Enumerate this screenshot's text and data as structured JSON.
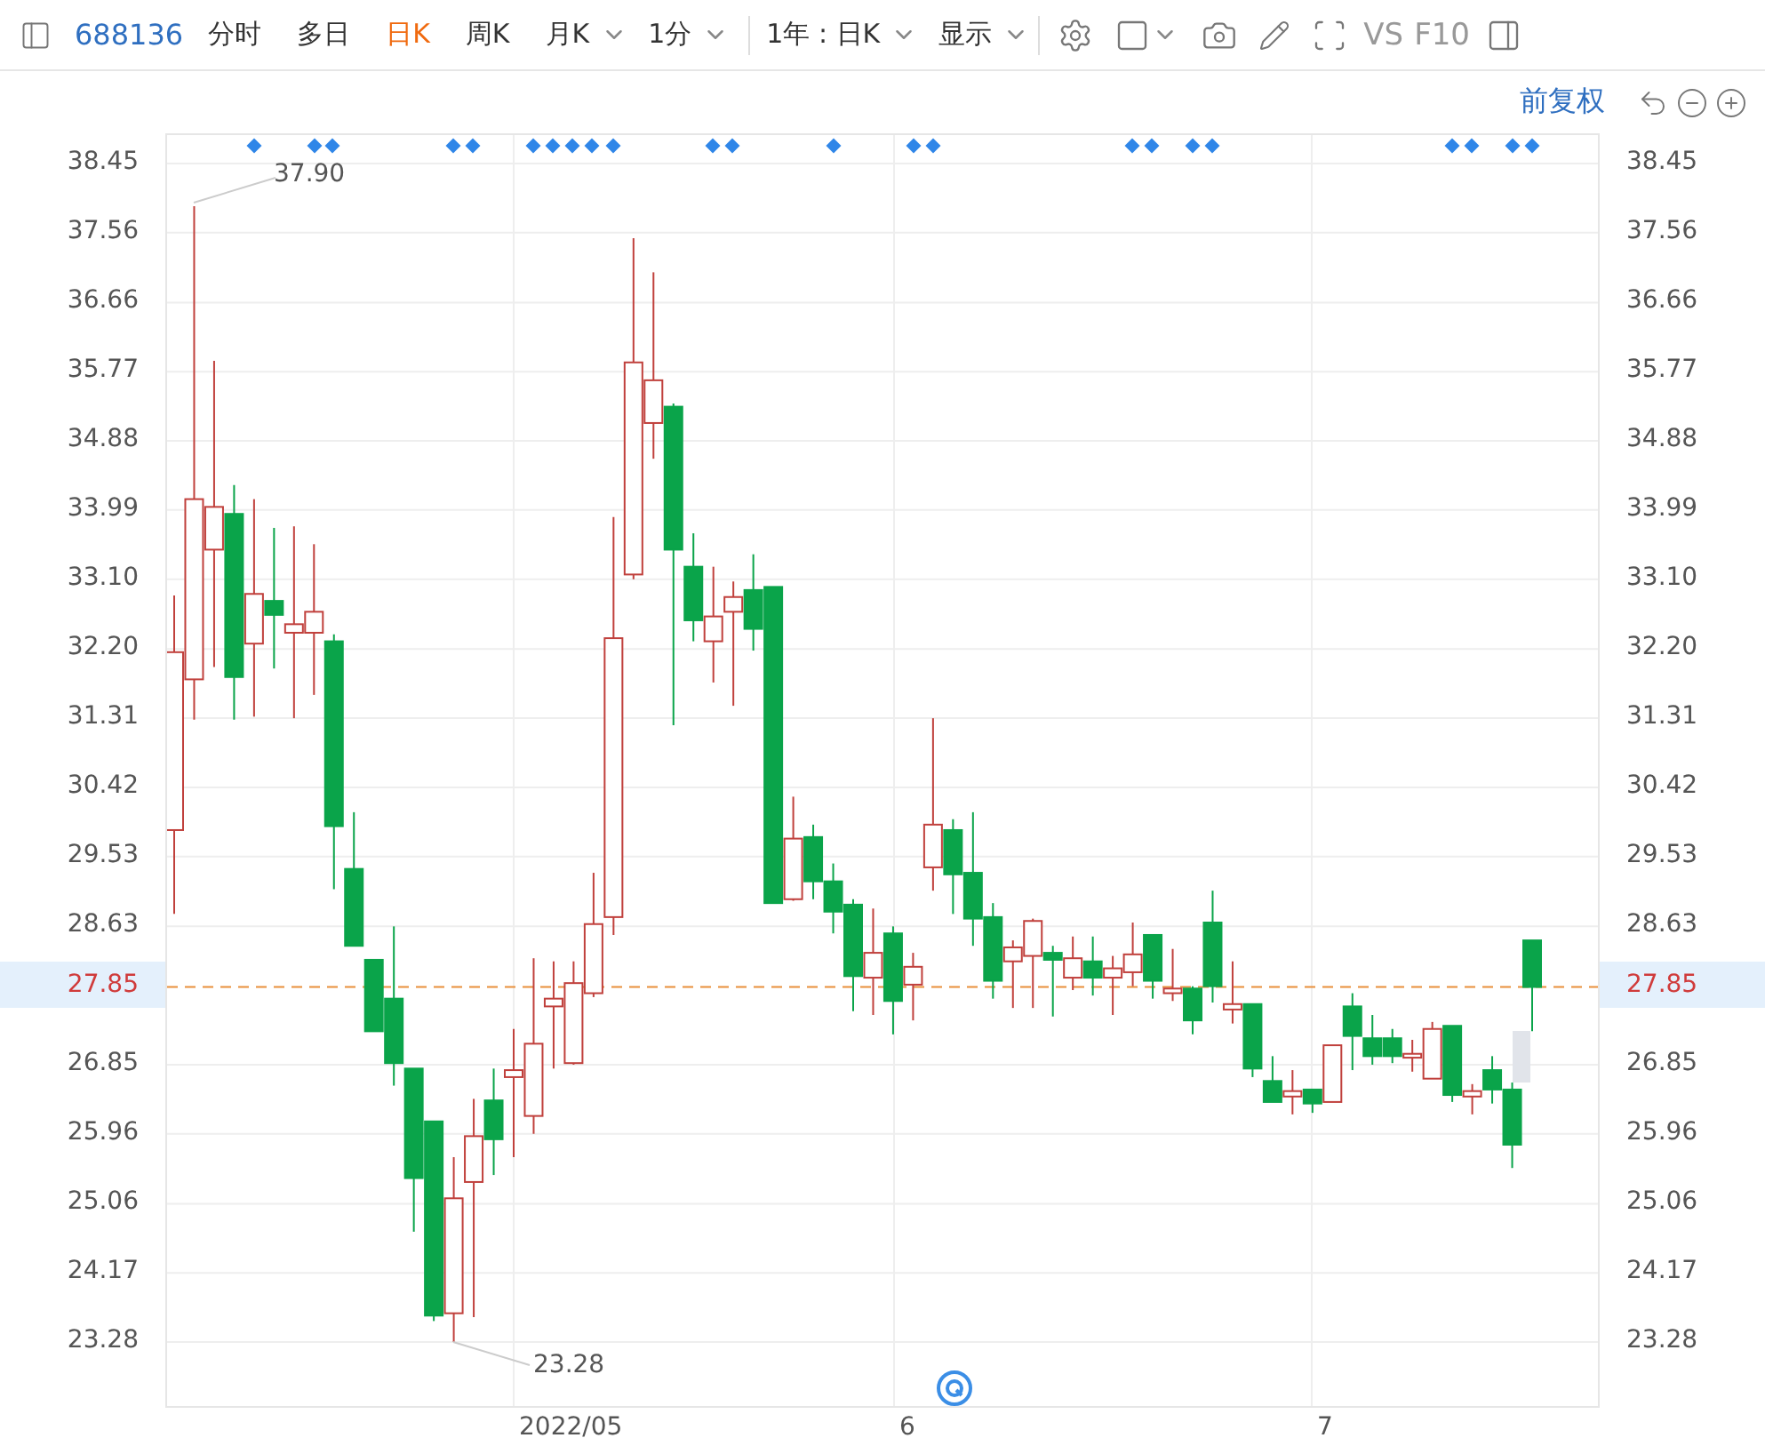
{
  "toolbar": {
    "code": "688136",
    "tabs": [
      {
        "label": "分时",
        "selected": false,
        "kind": "tab"
      },
      {
        "label": "多日",
        "selected": false,
        "kind": "tab"
      },
      {
        "label": "日K",
        "selected": true,
        "kind": "tab"
      },
      {
        "label": "周K",
        "selected": false,
        "kind": "tab"
      },
      {
        "label": "月K",
        "selected": false,
        "kind": "dropdown"
      },
      {
        "label": "1分",
        "selected": false,
        "kind": "dropdown"
      }
    ],
    "period": "1年 : 日K",
    "display": "显示",
    "compare": "VS",
    "f10": "F10"
  },
  "adjust": "前复权",
  "chart": {
    "right_ticks": [
      "38.45",
      "37.56",
      "36.66",
      "35.77",
      "34.88",
      "33.99",
      "33.10",
      "32.20",
      "31.31",
      "30.42",
      "29.53",
      "28.63",
      "26.85",
      "25.96",
      "25.06",
      "24.17",
      "23.28"
    ],
    "x_labels": [
      "2022/05",
      "6",
      "7"
    ],
    "left_price": "27.85",
    "right_price": "27.85",
    "high_label": "37.90",
    "low_label": "23.28",
    "chart_data": {
      "type": "candlestick",
      "ylim": [
        23.28,
        38.45
      ],
      "yticks": [
        {
          "value": 38.45,
          "label": "38.45"
        },
        {
          "value": 37.56,
          "label": "37.56"
        },
        {
          "value": 36.66,
          "label": "36.66"
        },
        {
          "value": 35.77,
          "label": "35.77"
        },
        {
          "value": 34.88,
          "label": "34.88"
        },
        {
          "value": 33.99,
          "label": "33.99"
        },
        {
          "value": 33.1,
          "label": "33.10"
        },
        {
          "value": 32.2,
          "label": "32.20"
        },
        {
          "value": 31.31,
          "label": "31.31"
        },
        {
          "value": 30.42,
          "label": "30.42"
        },
        {
          "value": 29.53,
          "label": "29.53"
        },
        {
          "value": 28.63,
          "label": "28.63"
        },
        {
          "value": 26.85,
          "label": "26.85"
        },
        {
          "value": 25.96,
          "label": "25.96"
        },
        {
          "value": 25.06,
          "label": "25.06"
        },
        {
          "value": 24.17,
          "label": "24.17"
        },
        {
          "value": 23.28,
          "label": "23.28"
        }
      ],
      "grid": true,
      "ref_lines": [
        {
          "axis": "y",
          "value": 27.85,
          "color": "#e8903a"
        }
      ],
      "categories": [
        null,
        null,
        null,
        null,
        null,
        null,
        null,
        null,
        null,
        null,
        null,
        null,
        null,
        null,
        null,
        null,
        null,
        null,
        null,
        null,
        null,
        null,
        null,
        null,
        null,
        null,
        null,
        null,
        null,
        null,
        null,
        null,
        null,
        null,
        null,
        null,
        null,
        null,
        null,
        null,
        null,
        null,
        null,
        null,
        null,
        null,
        null,
        null,
        null,
        null,
        null,
        null,
        null,
        null,
        null,
        null,
        null,
        null,
        null,
        null,
        null,
        null,
        null,
        null,
        null,
        null,
        null,
        null,
        null
      ],
      "ohlc": [
        [
          29.87,
          32.89,
          28.79,
          32.16
        ],
        [
          31.81,
          37.9,
          31.29,
          34.13
        ],
        [
          33.48,
          35.91,
          31.97,
          34.03
        ],
        [
          33.94,
          34.31,
          31.29,
          31.84
        ],
        [
          32.27,
          34.13,
          31.33,
          32.91
        ],
        [
          32.82,
          33.76,
          31.95,
          32.64
        ],
        [
          32.41,
          33.78,
          31.31,
          32.52
        ],
        [
          32.41,
          33.55,
          31.61,
          32.68
        ],
        [
          32.3,
          32.39,
          29.11,
          29.92
        ],
        [
          29.37,
          30.1,
          28.38,
          28.38
        ],
        [
          28.2,
          28.2,
          27.28,
          27.28
        ],
        [
          27.7,
          28.63,
          26.58,
          26.87
        ],
        [
          26.8,
          26.8,
          24.7,
          25.39
        ],
        [
          26.12,
          26.12,
          23.55,
          23.62
        ],
        [
          23.65,
          25.66,
          23.28,
          25.13
        ],
        [
          25.34,
          26.41,
          23.6,
          25.93
        ],
        [
          26.39,
          26.8,
          25.43,
          25.89
        ],
        [
          26.69,
          27.31,
          25.66,
          26.78
        ],
        [
          26.19,
          28.22,
          25.96,
          27.12
        ],
        [
          27.6,
          28.18,
          26.8,
          27.7
        ],
        [
          26.87,
          28.18,
          26.85,
          27.9
        ],
        [
          27.77,
          29.32,
          27.72,
          28.66
        ],
        [
          28.75,
          33.9,
          28.52,
          32.34
        ],
        [
          33.16,
          37.49,
          33.1,
          35.89
        ],
        [
          35.11,
          37.05,
          34.65,
          35.66
        ],
        [
          35.32,
          35.36,
          31.22,
          33.48
        ],
        [
          33.26,
          33.69,
          32.3,
          32.57
        ],
        [
          32.3,
          33.26,
          31.77,
          32.62
        ],
        [
          32.68,
          33.07,
          31.47,
          32.87
        ],
        [
          32.96,
          33.42,
          32.18,
          32.46
        ],
        [
          33.0,
          33.0,
          28.93,
          28.93
        ],
        [
          28.98,
          30.3,
          28.96,
          29.76
        ],
        [
          29.78,
          29.94,
          28.98,
          29.21
        ],
        [
          29.21,
          29.44,
          28.54,
          28.82
        ],
        [
          28.91,
          28.98,
          27.54,
          27.99
        ],
        [
          27.97,
          28.86,
          27.49,
          28.29
        ],
        [
          28.54,
          28.63,
          27.24,
          27.67
        ],
        [
          27.88,
          28.29,
          27.42,
          28.11
        ],
        [
          29.39,
          31.31,
          29.09,
          29.94
        ],
        [
          29.87,
          30.01,
          28.79,
          29.3
        ],
        [
          29.32,
          30.1,
          28.38,
          28.73
        ],
        [
          28.75,
          28.93,
          27.7,
          27.93
        ],
        [
          28.18,
          28.45,
          27.58,
          28.36
        ],
        [
          28.25,
          28.73,
          27.58,
          28.7
        ],
        [
          28.29,
          28.38,
          27.47,
          28.2
        ],
        [
          27.97,
          28.5,
          27.81,
          28.22
        ],
        [
          28.18,
          28.5,
          27.74,
          27.97
        ],
        [
          27.97,
          28.25,
          27.49,
          28.09
        ],
        [
          28.04,
          28.68,
          27.86,
          28.27
        ],
        [
          28.52,
          28.52,
          27.7,
          27.93
        ],
        [
          27.77,
          28.34,
          27.67,
          27.83
        ],
        [
          27.83,
          27.86,
          27.24,
          27.42
        ],
        [
          28.68,
          29.09,
          27.65,
          27.86
        ],
        [
          27.56,
          28.18,
          27.38,
          27.63
        ],
        [
          27.63,
          27.63,
          26.69,
          26.8
        ],
        [
          26.64,
          26.96,
          26.37,
          26.37
        ],
        [
          26.44,
          26.78,
          26.21,
          26.51
        ],
        [
          26.53,
          26.53,
          26.23,
          26.35
        ],
        [
          26.37,
          27.1,
          26.37,
          27.1
        ],
        [
          27.6,
          27.77,
          26.78,
          27.22
        ],
        [
          27.19,
          27.49,
          26.85,
          26.96
        ],
        [
          27.19,
          27.31,
          26.87,
          26.96
        ],
        [
          26.94,
          27.17,
          26.76,
          26.99
        ],
        [
          26.67,
          27.4,
          26.67,
          27.31
        ],
        [
          27.35,
          27.35,
          26.37,
          26.46
        ],
        [
          26.44,
          26.6,
          26.21,
          26.51
        ],
        [
          26.78,
          26.96,
          26.35,
          26.53
        ],
        [
          26.53,
          26.62,
          25.52,
          25.82
        ],
        [
          28.45,
          28.45,
          27.28,
          27.85
        ]
      ]
    }
  }
}
